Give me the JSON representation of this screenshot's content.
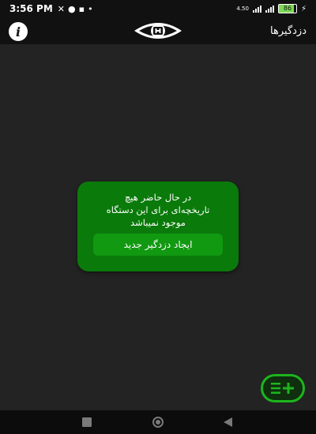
{
  "status_bar": {
    "time": "3:56 PM",
    "network_speed": "4.50",
    "battery_level": "86"
  },
  "app_bar": {
    "title": "دزدگیرها",
    "info_icon": "info-icon",
    "logo_icon": "eye-lock-logo"
  },
  "empty_state": {
    "message_line1": "در حال حاضر هیچ",
    "message_line2": "تاریخچه‌ای برای این دستگاه",
    "message_line3": "موجود نمیباشد",
    "create_button_label": "ایجاد دزدگیر جدید"
  },
  "fab": {
    "icon": "list-add-icon"
  },
  "colors": {
    "background": "#232323",
    "card": "#0a7a0a",
    "button": "#119911",
    "fab_border": "#1db51d"
  }
}
